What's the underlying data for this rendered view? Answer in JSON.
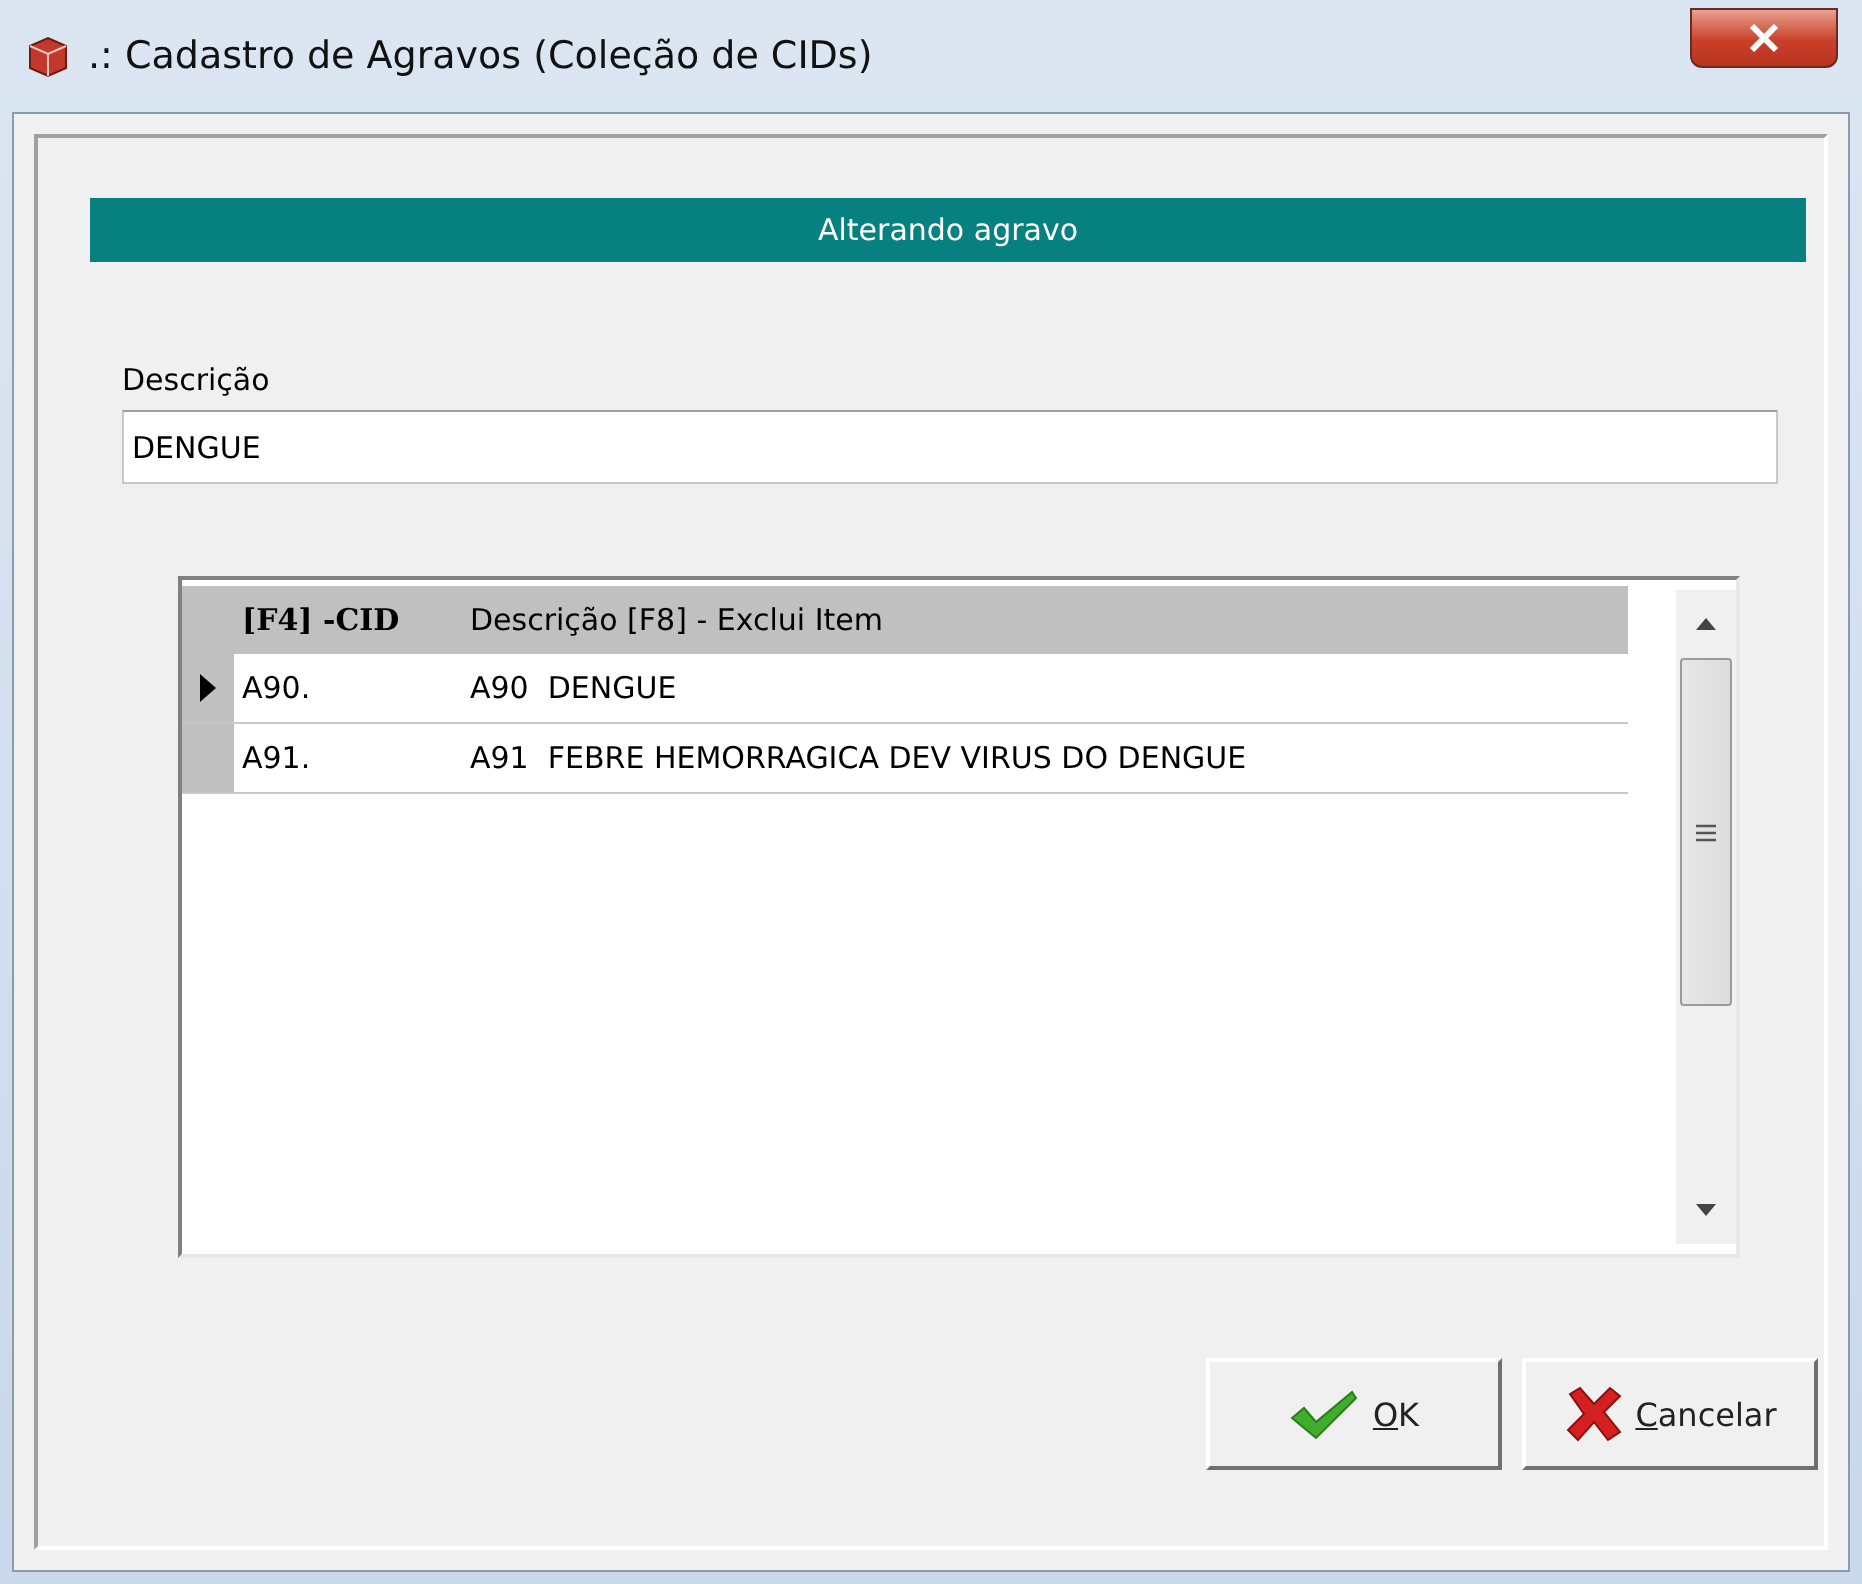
{
  "window": {
    "title": ".: Cadastro de Agravos (Coleção de CIDs)"
  },
  "header": {
    "title": "Alterando agravo"
  },
  "description_field": {
    "label": "Descrição",
    "value": "DENGUE"
  },
  "grid": {
    "columns": [
      "[F4] -CID",
      "Descrição [F8] - Exclui Item"
    ],
    "rows": [
      {
        "cells": [
          "A90.",
          "A90  DENGUE"
        ],
        "selected": true
      },
      {
        "cells": [
          "A91.",
          "A91  FEBRE HEMORRAGICA DEV VIRUS DO DENGUE"
        ],
        "selected": false
      }
    ]
  },
  "buttons": [
    {
      "kind": "ok",
      "label": "OK"
    },
    {
      "kind": "cancel",
      "label": "Cancelar"
    }
  ]
}
